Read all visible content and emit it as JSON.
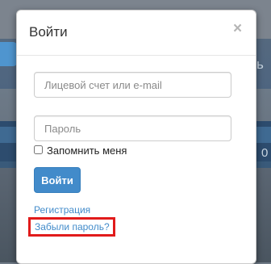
{
  "background": {
    "right_text_top": "ь",
    "right_text_bottom": "0"
  },
  "modal": {
    "title": "Войти",
    "close_symbol": "×",
    "login_placeholder": "Лицевой счет или e-mail",
    "password_placeholder": "Пароль",
    "remember_label": "Запомнить меня",
    "remember_checked": false,
    "submit_label": "Войти",
    "register_link": "Регистрация",
    "forgot_link": "Забыли пароль?"
  },
  "colors": {
    "primary_button": "#428bca",
    "link": "#428bca",
    "highlight_box": "#e11b1b"
  }
}
